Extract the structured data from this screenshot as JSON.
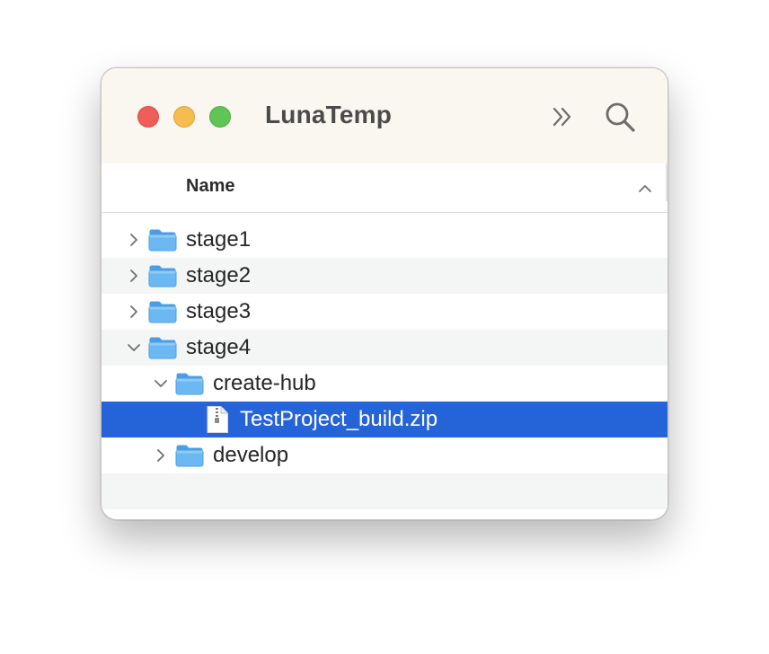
{
  "window": {
    "title": "LunaTemp"
  },
  "toolbar": {
    "more_icon": "chevron-double-right-icon",
    "search_icon": "search-icon"
  },
  "columns": {
    "name_header": "Name",
    "sort_direction": "ascending"
  },
  "files": [
    {
      "label": "stage1",
      "kind": "folder",
      "depth": 0,
      "expanded": false,
      "selected": false
    },
    {
      "label": "stage2",
      "kind": "folder",
      "depth": 0,
      "expanded": false,
      "selected": false
    },
    {
      "label": "stage3",
      "kind": "folder",
      "depth": 0,
      "expanded": false,
      "selected": false
    },
    {
      "label": "stage4",
      "kind": "folder",
      "depth": 0,
      "expanded": true,
      "selected": false
    },
    {
      "label": "create-hub",
      "kind": "folder",
      "depth": 1,
      "expanded": true,
      "selected": false
    },
    {
      "label": "TestProject_build.zip",
      "kind": "zip",
      "depth": 2,
      "expanded": false,
      "selected": true
    },
    {
      "label": "develop",
      "kind": "folder",
      "depth": 1,
      "expanded": false,
      "selected": false
    }
  ],
  "colors": {
    "selection": "#2563d8",
    "folder": "#5aaef0",
    "titlebar": "#faf7f0",
    "close": "#ee5f57",
    "minimize": "#f5bd4f",
    "zoom": "#61c554"
  }
}
